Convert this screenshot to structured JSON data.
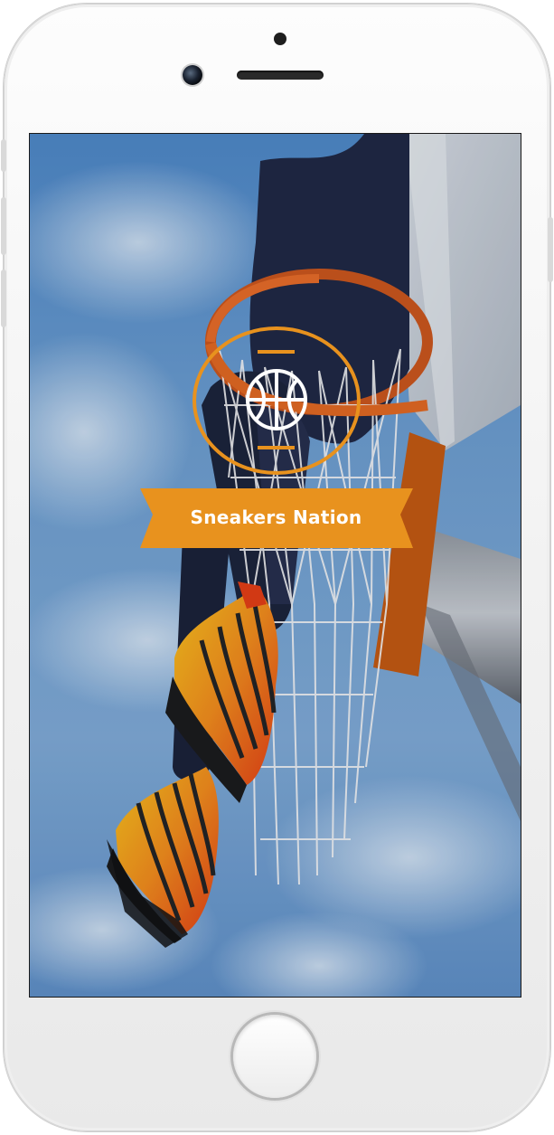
{
  "app": {
    "title": "Sneakers Nation"
  },
  "splash": {
    "logo_icon": "basketball-icon",
    "background_image": "basketball-dunk-sneakers-photo"
  },
  "device": {
    "home_button_icon": "home-button"
  },
  "colors": {
    "accent": "#e8921e",
    "sky": "#6b97c6",
    "logo_line": "#ffffff"
  }
}
